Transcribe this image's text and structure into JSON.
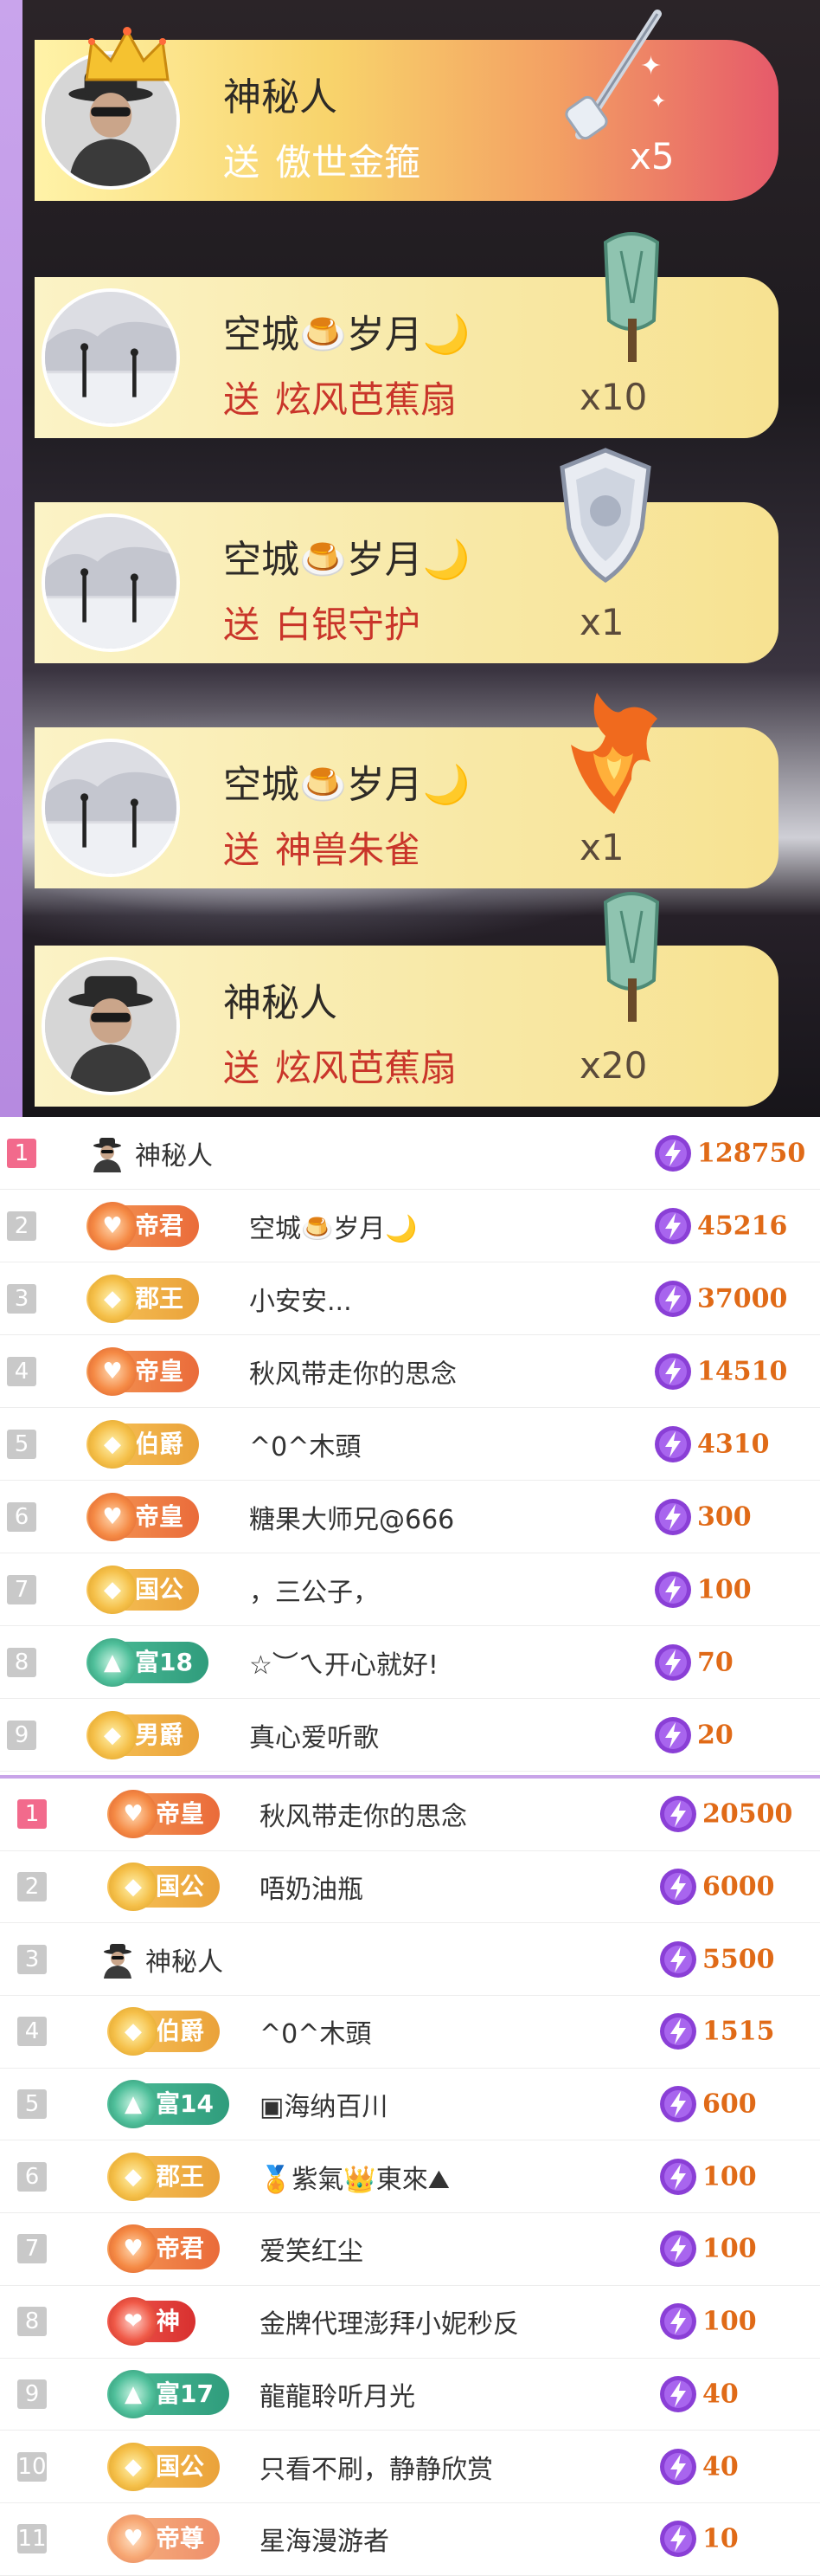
{
  "gift_feed": [
    {
      "sender": "神秘人",
      "verb": "送",
      "gift": "傲世金箍",
      "quantity": "x5",
      "avatar": "mystery-man",
      "highlighted": true,
      "gift_icon": "golden-staff-icon"
    },
    {
      "sender": "空城🍮岁月🌙",
      "verb": "送",
      "gift": "炫风芭蕉扇",
      "quantity": "x10",
      "avatar": "snow-landscape",
      "highlighted": false,
      "gift_icon": "banana-fan-icon"
    },
    {
      "sender": "空城🍮岁月🌙",
      "verb": "送",
      "gift": "白银守护",
      "quantity": "x1",
      "avatar": "snow-landscape",
      "highlighted": false,
      "gift_icon": "silver-shield-icon"
    },
    {
      "sender": "空城🍮岁月🌙",
      "verb": "送",
      "gift": "神兽朱雀",
      "quantity": "x1",
      "avatar": "snow-landscape",
      "highlighted": false,
      "gift_icon": "phoenix-icon"
    },
    {
      "sender": "神秘人",
      "verb": "送",
      "gift": "炫风芭蕉扇",
      "quantity": "x20",
      "avatar": "mystery-man",
      "highlighted": false,
      "gift_icon": "banana-fan-icon"
    }
  ],
  "ranking_1": [
    {
      "rank": "1",
      "badge": null,
      "name": "神秘人",
      "score": "128750"
    },
    {
      "rank": "2",
      "badge": {
        "label": "帝君",
        "style": "orange"
      },
      "name": "空城🍮岁月🌙",
      "score": "45216"
    },
    {
      "rank": "3",
      "badge": {
        "label": "郡王",
        "style": "gold"
      },
      "name": "小安安...",
      "score": "37000"
    },
    {
      "rank": "4",
      "badge": {
        "label": "帝皇",
        "style": "orange"
      },
      "name": "秋风带走你的思念",
      "score": "14510"
    },
    {
      "rank": "5",
      "badge": {
        "label": "伯爵",
        "style": "gold"
      },
      "name": "^0^木頭",
      "score": "4310"
    },
    {
      "rank": "6",
      "badge": {
        "label": "帝皇",
        "style": "orange"
      },
      "name": "糖果大师兄@666",
      "score": "300"
    },
    {
      "rank": "7",
      "badge": {
        "label": "国公",
        "style": "gold"
      },
      "name": "，三公子，",
      "score": "100"
    },
    {
      "rank": "8",
      "badge": {
        "label": "富18",
        "style": "teal"
      },
      "name": "☆︶ㄟ开心就好!",
      "score": "70"
    },
    {
      "rank": "9",
      "badge": {
        "label": "男爵",
        "style": "gold"
      },
      "name": "真心爱听歌",
      "score": "20"
    }
  ],
  "ranking_2": [
    {
      "rank": "1",
      "badge": {
        "label": "帝皇",
        "style": "orange"
      },
      "name": "秋风带走你的思念",
      "score": "20500"
    },
    {
      "rank": "2",
      "badge": {
        "label": "国公",
        "style": "gold"
      },
      "name": "唔奶油瓶",
      "score": "6000"
    },
    {
      "rank": "3",
      "badge": null,
      "name": "神秘人",
      "score": "5500"
    },
    {
      "rank": "4",
      "badge": {
        "label": "伯爵",
        "style": "gold"
      },
      "name": "^0^木頭",
      "score": "1515"
    },
    {
      "rank": "5",
      "badge": {
        "label": "富14",
        "style": "teal"
      },
      "name": "▣海纳百川",
      "score": "600"
    },
    {
      "rank": "6",
      "badge": {
        "label": "郡王",
        "style": "gold"
      },
      "name": "🏅紫氣👑東來⛰",
      "score": "100"
    },
    {
      "rank": "7",
      "badge": {
        "label": "帝君",
        "style": "orange"
      },
      "name": "爱笑红尘",
      "score": "100"
    },
    {
      "rank": "8",
      "badge": {
        "label": "神",
        "style": "red"
      },
      "name": "金牌代理澎拜小妮秒反",
      "score": "100"
    },
    {
      "rank": "9",
      "badge": {
        "label": "富17",
        "style": "teal"
      },
      "name": "龍龍聆听月光",
      "score": "40"
    },
    {
      "rank": "10",
      "badge": {
        "label": "国公",
        "style": "gold"
      },
      "name": "只看不刷，静静欣赏",
      "score": "40"
    },
    {
      "rank": "11",
      "badge": {
        "label": "帝尊",
        "style": "orange-faded"
      },
      "name": "星海漫游者",
      "score": "10"
    }
  ],
  "colors": {
    "rank_first": "#f26a8c",
    "rank_default": "#c9c9c9",
    "score": "#e06a17",
    "coin": "#8a3fd6",
    "gift_text": "#c9352a",
    "divider": "#c8a4e8"
  }
}
